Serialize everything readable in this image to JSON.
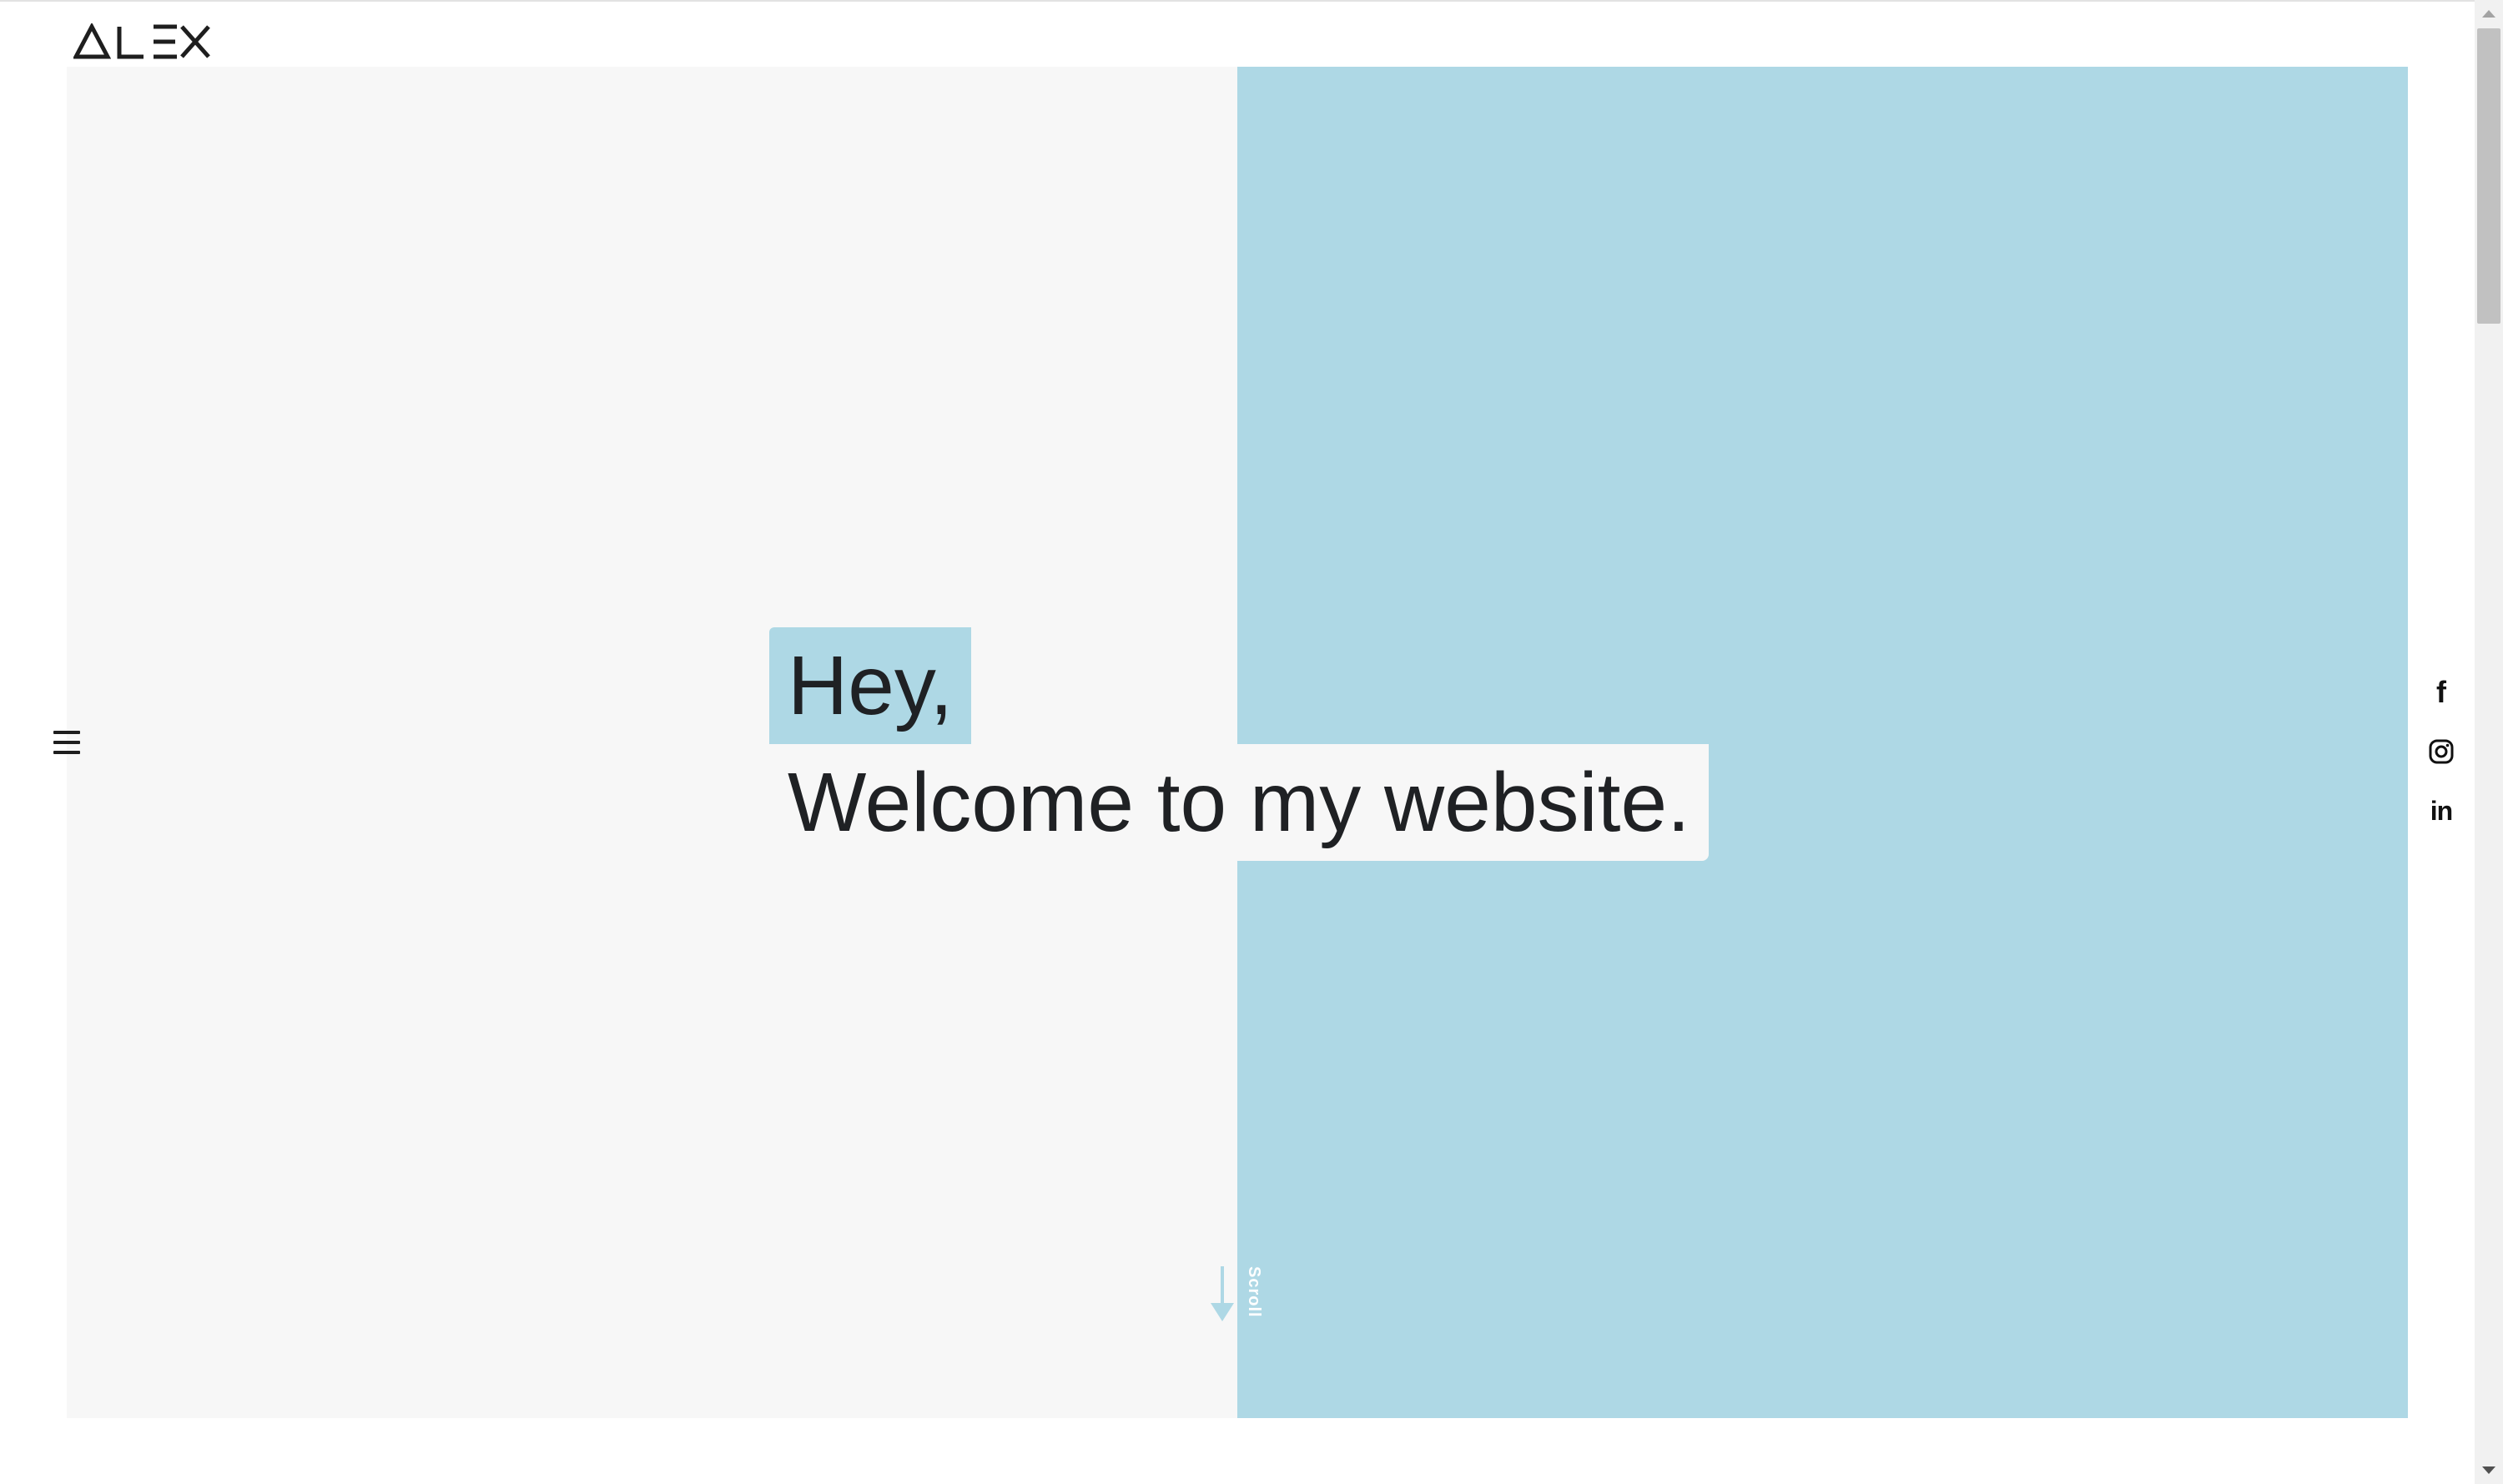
{
  "brand": {
    "logo_text": "ALEX"
  },
  "hero": {
    "line1": "Hey,",
    "line2": "Welcome to my website.",
    "scroll_label": "Scroll"
  },
  "nav": {
    "menu_icon": "hamburger-icon"
  },
  "social": [
    {
      "icon": "facebook-icon",
      "glyph": "f"
    },
    {
      "icon": "instagram-icon"
    },
    {
      "icon": "linkedin-icon",
      "glyph": "in"
    }
  ],
  "colors": {
    "accent": "#aed8e5",
    "panel_light": "#f7f7f7",
    "text": "#1f2124",
    "background": "#ffffff"
  }
}
